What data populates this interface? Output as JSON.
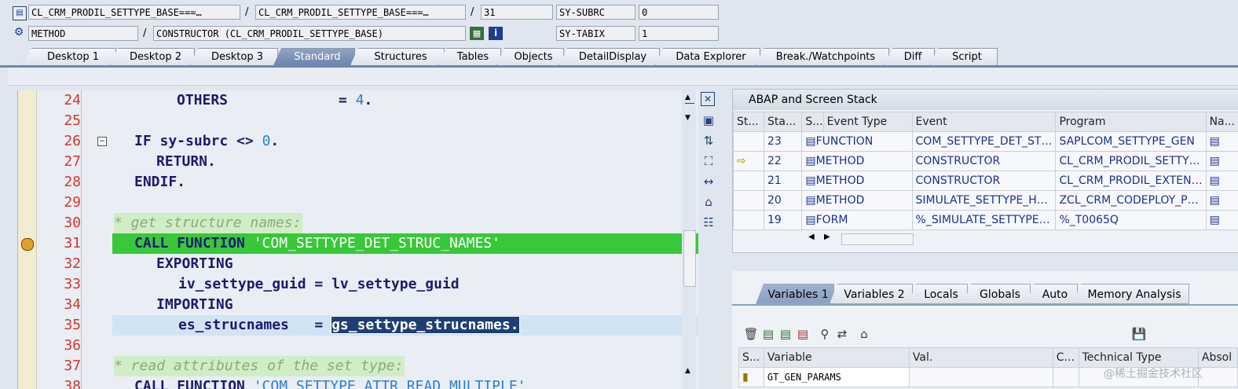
{
  "header": {
    "row1": {
      "field1": "CL_CRM_PRODIL_SETTYPE_BASE===…",
      "field2": "CL_CRM_PRODIL_SETTYPE_BASE===…",
      "field3": "31",
      "sysfield": "SY-SUBRC",
      "sysvalue": "0",
      "sep": "/"
    },
    "row2": {
      "field1": "METHOD",
      "field2": "CONSTRUCTOR (CL_CRM_PRODIL_SETTYPE_BASE)",
      "sysfield": "SY-TABIX",
      "sysvalue": "1",
      "sep": "/"
    }
  },
  "tabs": [
    "Desktop 1",
    "Desktop 2",
    "Desktop 3",
    "Standard",
    "Structures",
    "Tables",
    "Objects",
    "DetailDisplay",
    "Data Explorer",
    "Break./Watchpoints",
    "Diff",
    "Script"
  ],
  "active_tab": "Standard",
  "code_lines": [
    {
      "num": "24",
      "text": "    OTHERS             = 4."
    },
    {
      "num": "25",
      "text": ""
    },
    {
      "num": "26",
      "text": "  IF sy-subrc <> 0."
    },
    {
      "num": "27",
      "text": "    RETURN."
    },
    {
      "num": "28",
      "text": "  ENDIF."
    },
    {
      "num": "29",
      "text": ""
    },
    {
      "num": "30",
      "text": "* get structure names:"
    },
    {
      "num": "31",
      "text": "  CALL FUNCTION 'COM_SETTYPE_DET_STRUC_NAMES'"
    },
    {
      "num": "32",
      "text": "    EXPORTING"
    },
    {
      "num": "33",
      "text": "      iv_settype_guid = lv_settype_guid"
    },
    {
      "num": "34",
      "text": "    IMPORTING"
    },
    {
      "num": "35",
      "text": "      es_strucnames   = gs_settype_strucnames."
    },
    {
      "num": "36",
      "text": ""
    },
    {
      "num": "37",
      "text": "* read attributes of the set type:"
    },
    {
      "num": "38",
      "text": "  CALL FUNCTION 'COM_SETTYPE_ATTR_READ_MULTIPLE'"
    }
  ],
  "stack": {
    "title": "ABAP and Screen Stack",
    "columns": [
      "St...",
      "Sta...",
      "S...",
      "Event Type",
      "Event",
      "Program",
      "Na..."
    ],
    "rows": [
      {
        "level": "23",
        "type": "FUNCTION",
        "event": "COM_SETTYPE_DET_ST…",
        "program": "SAPLCOM_SETTYPE_GEN"
      },
      {
        "level": "22",
        "type": "METHOD",
        "event": "CONSTRUCTOR",
        "program": "CL_CRM_PRODIL_SETTY…",
        "current": true
      },
      {
        "level": "21",
        "type": "METHOD",
        "event": "CONSTRUCTOR",
        "program": "CL_CRM_PRODIL_EXTEN…"
      },
      {
        "level": "20",
        "type": "METHOD",
        "event": "SIMULATE_SETTYPE_H…",
        "program": "ZCL_CRM_CODEPLOY_P…"
      },
      {
        "level": "19",
        "type": "FORM",
        "event": "%_SIMULATE_SETTYPE…",
        "program": "%_T0065Q"
      }
    ]
  },
  "var_tabs": [
    "Variables 1",
    "Variables 2",
    "Locals",
    "Globals",
    "Auto",
    "Memory Analysis"
  ],
  "var_columns": [
    "S...",
    "Variable",
    "Val.",
    "C...",
    "Technical Type",
    "Absol"
  ],
  "var_rows": [
    {
      "variable": "GT_GEN_PARAMS"
    }
  ],
  "watermark": "@稀土掘金技术社区"
}
